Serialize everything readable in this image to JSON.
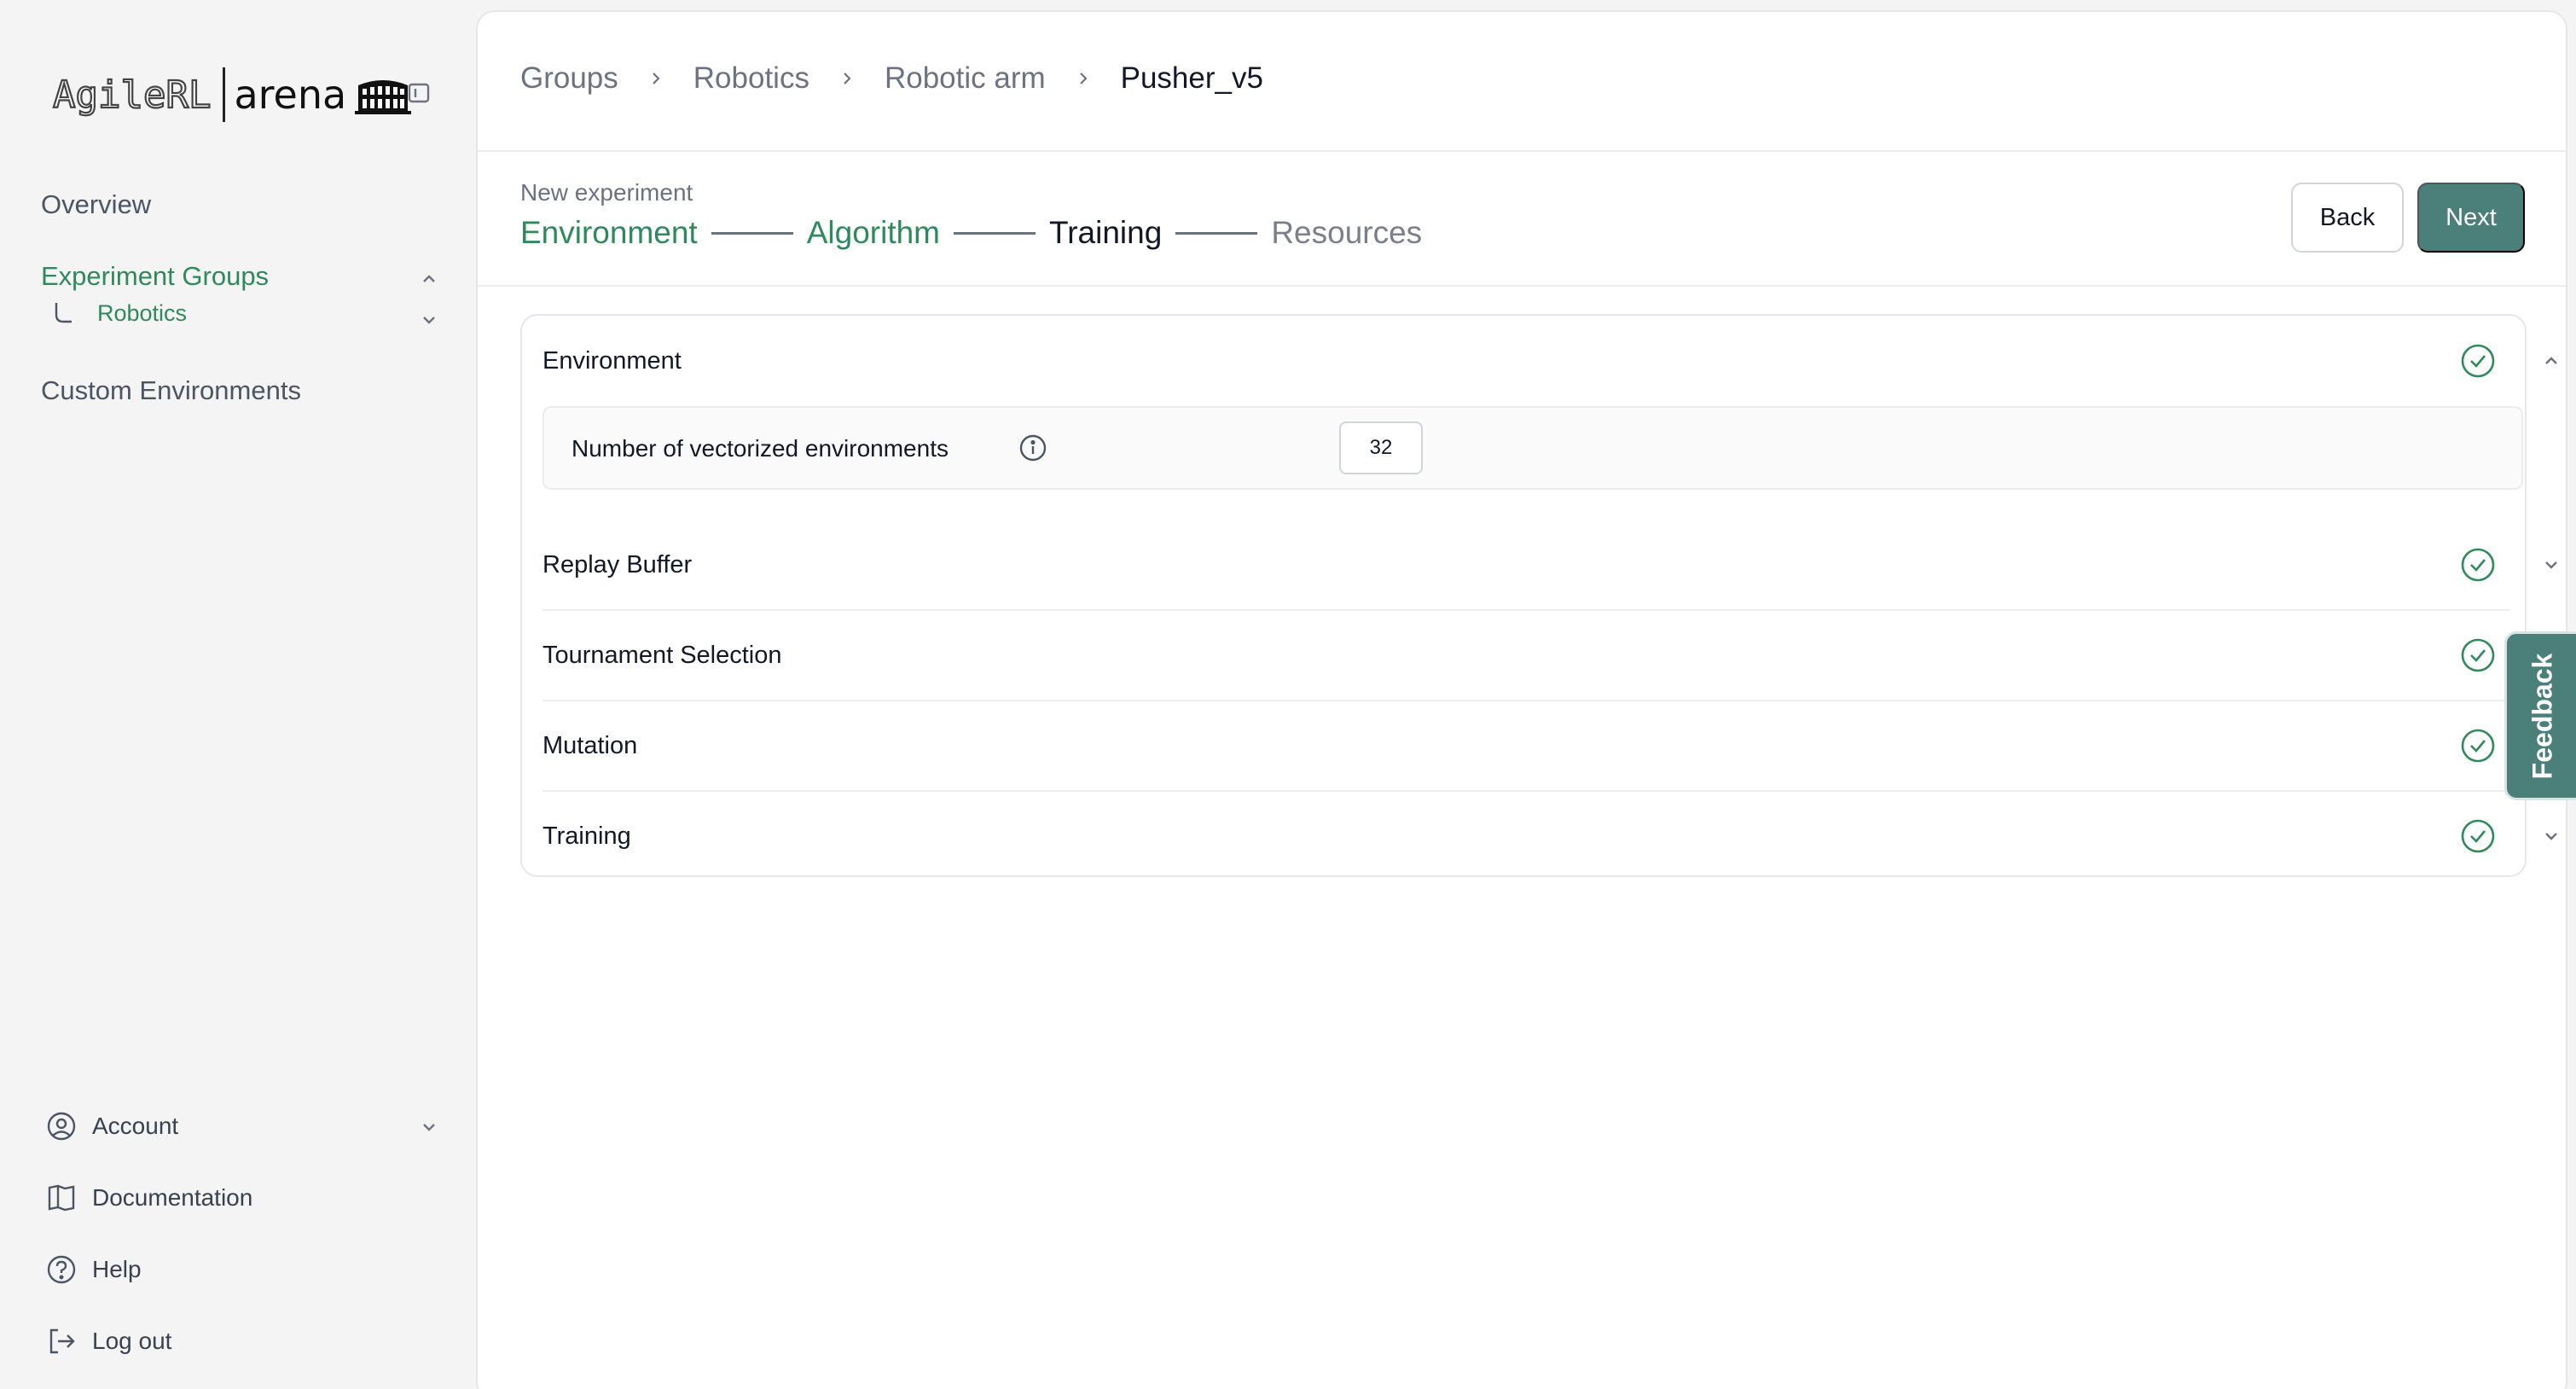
{
  "sidebar": {
    "logo": {
      "left": "AgileRL",
      "right": "arena"
    },
    "nav": {
      "overview": "Overview",
      "experiment_groups": "Experiment Groups",
      "robotics": "Robotics",
      "custom_environments": "Custom Environments"
    },
    "bottom": {
      "account": "Account",
      "documentation": "Documentation",
      "help": "Help",
      "logout": "Log out"
    }
  },
  "breadcrumb": [
    "Groups",
    "Robotics",
    "Robotic arm",
    "Pusher_v5"
  ],
  "wizard": {
    "heading": "New experiment",
    "steps": [
      "Environment",
      "Algorithm",
      "Training",
      "Resources"
    ],
    "back_label": "Back",
    "next_label": "Next"
  },
  "sections": {
    "environment": {
      "title": "Environment",
      "field_label": "Number of vectorized environments",
      "field_value": "32"
    },
    "replay_buffer": "Replay Buffer",
    "tournament_selection": "Tournament Selection",
    "mutation": "Mutation",
    "training": "Training"
  },
  "feedback_label": "Feedback",
  "colors": {
    "accent_green": "#2f8a5b",
    "button_teal": "#4b7f7a"
  },
  "icons": [
    "sidebar-toggle-icon",
    "chevron-up-icon",
    "chevron-down-icon",
    "tree-branch-icon",
    "user-circle-icon",
    "book-icon",
    "help-circle-icon",
    "logout-icon",
    "chevron-right-icon",
    "check-circle-icon",
    "info-icon"
  ]
}
